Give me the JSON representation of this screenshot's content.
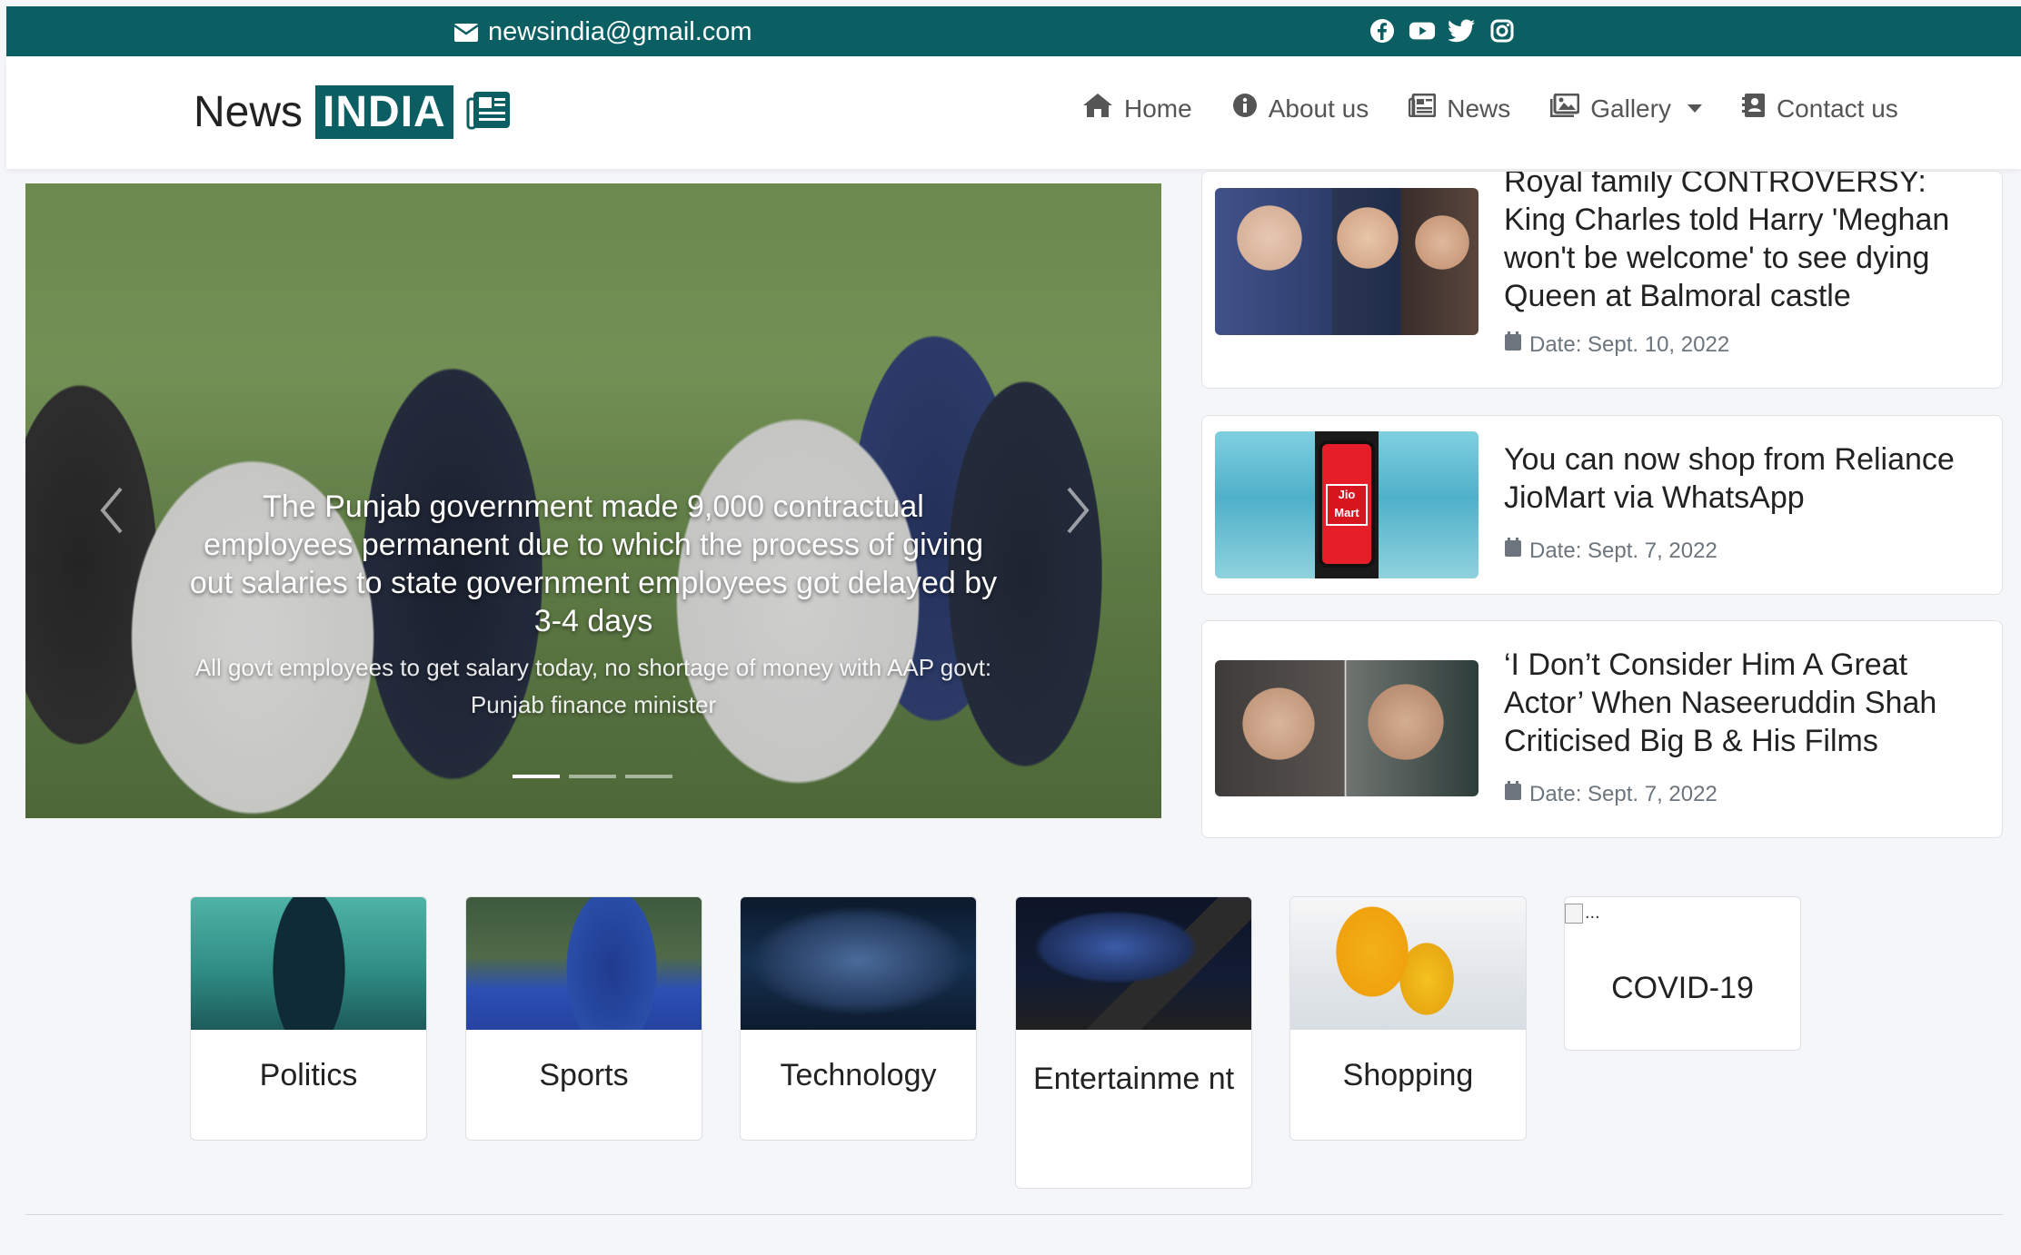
{
  "topbar": {
    "email": "newsindia@gmail.com",
    "social_icons": [
      "facebook-icon",
      "youtube-icon",
      "twitter-icon",
      "instagram-icon"
    ],
    "bg_color": "#0b5f62"
  },
  "brand": {
    "word": "News",
    "highlight": "INDIA"
  },
  "nav": {
    "home": "Home",
    "about": "About us",
    "news": "News",
    "gallery": "Gallery",
    "contact": "Contact us"
  },
  "carousel": {
    "title": "The Punjab government made 9,000 contractual employees permanent due to which the process of giving out salaries to state government employees got delayed by 3-4 days",
    "subtitle": "All govt employees to get salary today, no shortage of money with AAP govt: Punjab finance minister",
    "slides": 3,
    "active_slide": 1
  },
  "side_news": [
    {
      "title": "Royal family CONTROVERSY: King Charles told Harry 'Meghan won't be welcome' to see dying Queen at Balmoral castle",
      "date": "Date: Sept. 10, 2022"
    },
    {
      "title": "You can now shop from Reliance JioMart via WhatsApp",
      "date": "Date: Sept. 7, 2022",
      "thumb_logo": "Jio Mart"
    },
    {
      "title": "‘I Don’t Consider Him A Great Actor’ When Naseeruddin Shah Criticised Big B & His Films",
      "date": "Date: Sept. 7, 2022"
    }
  ],
  "categories": [
    {
      "label": "Politics"
    },
    {
      "label": "Sports"
    },
    {
      "label": "Technology"
    },
    {
      "label": "Entertainme nt"
    },
    {
      "label": "Shopping"
    },
    {
      "label": "COVID-19",
      "broken_alt": "..."
    }
  ]
}
